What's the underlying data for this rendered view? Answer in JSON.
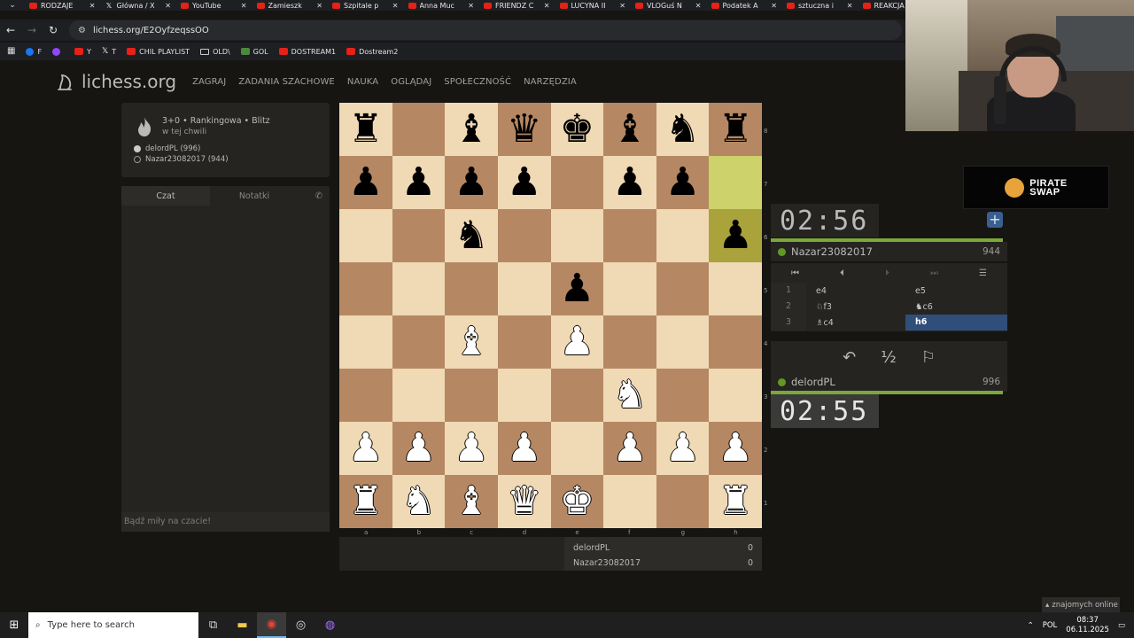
{
  "browser": {
    "tabs": [
      {
        "title": "RODZAJE",
        "icon": "youtube-icon"
      },
      {
        "title": "Główna / X",
        "icon": "x-icon"
      },
      {
        "title": "YouTube",
        "icon": "youtube-icon"
      },
      {
        "title": "Zamieszk",
        "icon": "youtube-icon"
      },
      {
        "title": "Szpitale p",
        "icon": "youtube-icon"
      },
      {
        "title": "Anna Muc",
        "icon": "youtube-icon"
      },
      {
        "title": "FRIENDZ C",
        "icon": "youtube-icon"
      },
      {
        "title": "LUCYNA II",
        "icon": "youtube-icon"
      },
      {
        "title": "VLOGuś N",
        "icon": "youtube-icon"
      },
      {
        "title": "Podatek A",
        "icon": "youtube-icon"
      },
      {
        "title": "sztuczna i",
        "icon": "youtube-icon"
      },
      {
        "title": "REAKCJA",
        "icon": "youtube-icon"
      }
    ],
    "url": "lichess.org/E2OyfzeqssOO",
    "bookmarks": [
      {
        "label": "F",
        "icon": "facebook-icon"
      },
      {
        "label": "",
        "icon": "twitch-icon"
      },
      {
        "label": "Y",
        "icon": "youtube-icon"
      },
      {
        "label": "T",
        "icon": "x-icon"
      },
      {
        "label": "CHIL PLAYLIST",
        "icon": "youtube-icon"
      },
      {
        "label": "OLD\\",
        "icon": "folder-icon"
      },
      {
        "label": "GOL",
        "icon": "gol-icon"
      },
      {
        "label": "DOSTREAM1",
        "icon": "youtube-icon"
      },
      {
        "label": "Dostream2",
        "icon": "youtube-icon"
      }
    ]
  },
  "site": {
    "logo": "lichess.org",
    "nav": [
      "ZAGRAJ",
      "ZADANIA SZACHOWE",
      "NAUKA",
      "OGLĄDAJ",
      "SPOŁECZNOŚĆ",
      "NARZĘDZIA"
    ]
  },
  "game_info": {
    "mode": "3+0 • Rankingowa • Blitz",
    "when": "w tej chwili",
    "white_player": "delordPL (996)",
    "black_player": "Nazar23082017 (944)"
  },
  "chat": {
    "tab_chat": "Czat",
    "tab_notes": "Notatki",
    "placeholder": "Bądź miły na czacie!"
  },
  "board": {
    "ranks": [
      "8",
      "7",
      "6",
      "5",
      "4",
      "3",
      "2",
      "1"
    ],
    "files": [
      "a",
      "b",
      "c",
      "d",
      "e",
      "f",
      "g",
      "h"
    ],
    "position": [
      [
        "r",
        "",
        "b",
        "q",
        "k",
        "b",
        "n",
        "r"
      ],
      [
        "p",
        "p",
        "p",
        "p",
        "",
        "p",
        "p",
        ""
      ],
      [
        "",
        "",
        "n",
        "",
        "",
        "",
        "",
        "p"
      ],
      [
        "",
        "",
        "",
        "",
        "p",
        "",
        "",
        ""
      ],
      [
        "",
        "",
        "B",
        "",
        "P",
        "",
        "",
        ""
      ],
      [
        "",
        "",
        "",
        "",
        "",
        "N",
        "",
        ""
      ],
      [
        "P",
        "P",
        "P",
        "P",
        "",
        "P",
        "P",
        "P"
      ],
      [
        "R",
        "N",
        "B",
        "Q",
        "K",
        "",
        "",
        "R"
      ]
    ],
    "last_move": [
      "h7",
      "h6"
    ]
  },
  "clocks": {
    "top": "02:56",
    "bottom": "02:55"
  },
  "players": {
    "top": {
      "name": "Nazar23082017",
      "rating": "944"
    },
    "bottom": {
      "name": "delordPL",
      "rating": "996"
    }
  },
  "moves": [
    {
      "n": "1",
      "white": "e4",
      "black": "e5"
    },
    {
      "n": "2",
      "white": "♘f3",
      "black": "♞c6"
    },
    {
      "n": "3",
      "white": "♗c4",
      "black": "h6"
    }
  ],
  "score": [
    {
      "name": "delordPL",
      "points": "0"
    },
    {
      "name": "Nazar23082017",
      "points": "0"
    }
  ],
  "ad": {
    "line1": "PIRATE",
    "line2": "SWAP"
  },
  "friends": "znajomych online",
  "taskbar": {
    "search_placeholder": "Type here to search",
    "lang": "POL",
    "time": "08:37",
    "date": "06.11.2025"
  }
}
